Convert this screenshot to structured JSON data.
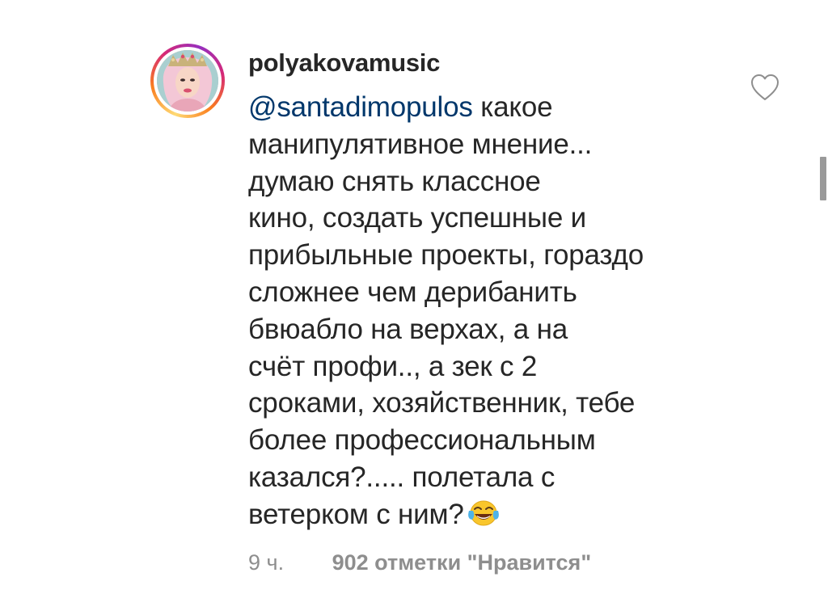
{
  "comment": {
    "username": "polyakovamusic",
    "mention": "@santadimopulos",
    "lines": [
      " какое",
      "манипулятивное мнение...",
      "думаю снять классное",
      "кино, создать успешные и",
      "прибыльные проекты, гораздо",
      "сложнее чем дерибанить",
      "бвюабло на верхах, а на",
      "счёт профи.., а зек с 2",
      "сроками, хозяйственник, тебе",
      "более профессиональным",
      "казался?..... полетала с",
      "ветерком с ним?"
    ],
    "emoji": "face-with-tears-of-joy",
    "time": "9 ч.",
    "likes": "902 отметки \"Нравится\""
  },
  "icons": {
    "like": "heart-outline-icon",
    "avatar": "profile-avatar"
  },
  "colors": {
    "text": "#262626",
    "mention": "#00376b",
    "meta": "#8e8e8e"
  }
}
